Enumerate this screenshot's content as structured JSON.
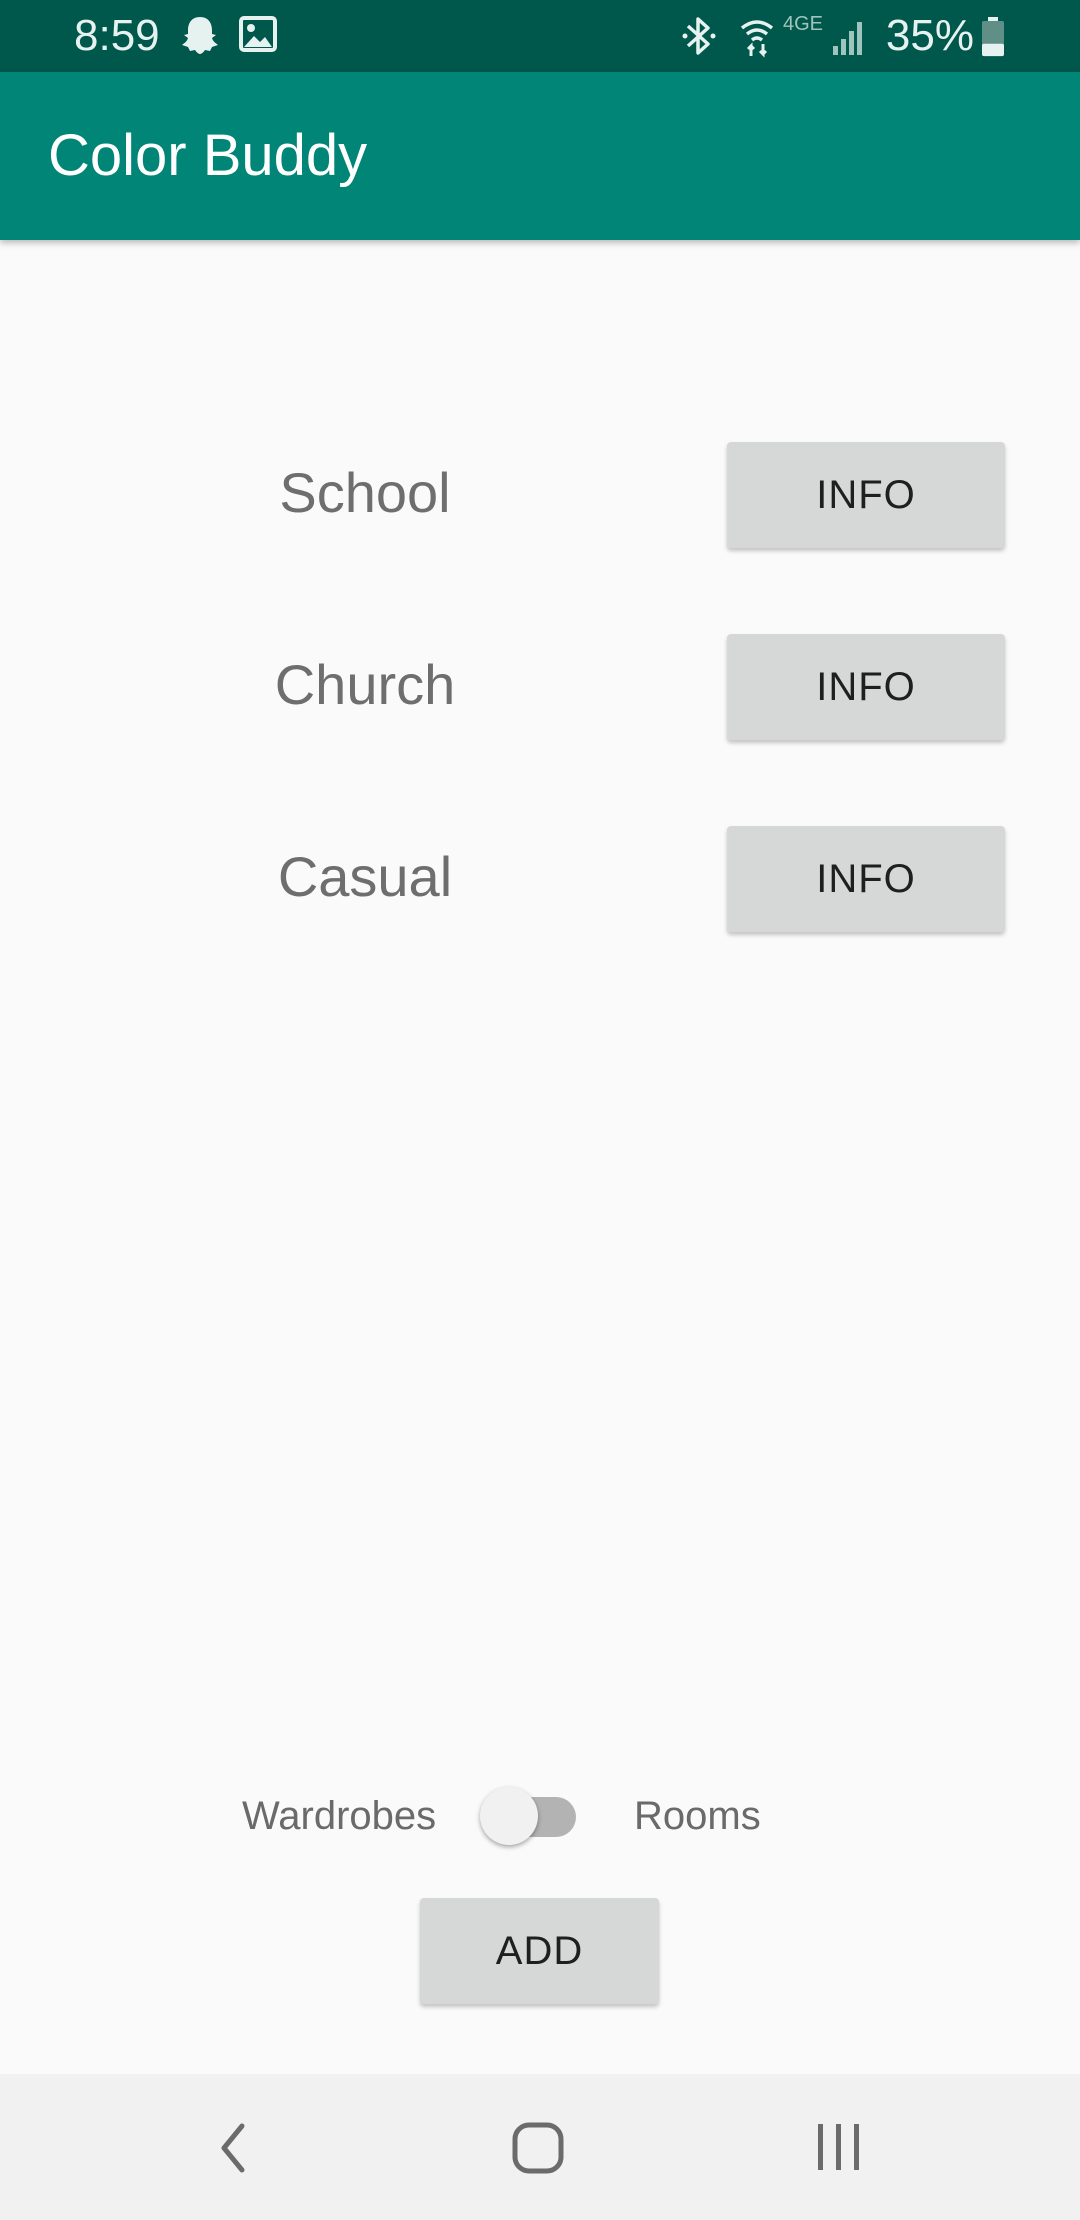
{
  "status_bar": {
    "time": "8:59",
    "battery_percent": "35%",
    "icons": [
      "snapchat-ghost-icon",
      "gallery-image-icon",
      "bluetooth-icon",
      "wifi-icon",
      "lte-4g-icon",
      "cellular-signal-icon",
      "battery-icon"
    ],
    "battery_level": 0.35
  },
  "app_bar": {
    "title": "Color Buddy"
  },
  "categories": [
    {
      "label": "School",
      "button": "INFO"
    },
    {
      "label": "Church",
      "button": "INFO"
    },
    {
      "label": "Casual",
      "button": "INFO"
    }
  ],
  "toggle": {
    "left_label": "Wardrobes",
    "right_label": "Rooms",
    "checked": false
  },
  "add_button": "ADD",
  "nav_bar": {
    "icons": [
      "back-icon",
      "home-icon",
      "recent-apps-icon"
    ]
  },
  "colors": {
    "status_bar": "#00574b",
    "app_bar": "#008577",
    "background": "#fafafa",
    "button": "#d6d7d7",
    "nav_bar": "#f1f1f1"
  }
}
